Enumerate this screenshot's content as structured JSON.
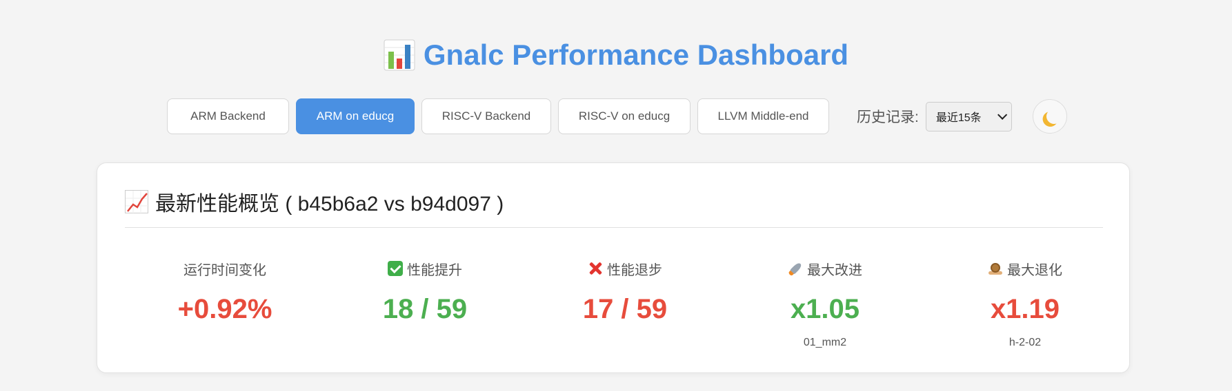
{
  "header": {
    "title": "Gnalc Performance Dashboard",
    "icon": "bar-chart-icon"
  },
  "tabs": [
    {
      "label": "ARM Backend",
      "active": false
    },
    {
      "label": "ARM on educg",
      "active": true
    },
    {
      "label": "RISC-V Backend",
      "active": false
    },
    {
      "label": "RISC-V on educg",
      "active": false
    },
    {
      "label": "LLVM Middle-end",
      "active": false
    }
  ],
  "history": {
    "label": "历史记录:",
    "selected": "最近15条"
  },
  "theme_toggle": {
    "icon": "moon-icon"
  },
  "overview": {
    "title": "最新性能概览 ( b45b6a2 vs b94d097 )",
    "icon": "chart-increasing-icon",
    "stats": [
      {
        "label": "运行时间变化",
        "value": "+0.92%",
        "sub": "",
        "icon": "",
        "color": "#e74c3c"
      },
      {
        "label": "性能提升",
        "value": "18 / 59",
        "sub": "",
        "icon": "check-icon",
        "color": "#4caf50"
      },
      {
        "label": "性能退步",
        "value": "17 / 59",
        "sub": "",
        "icon": "cross-icon",
        "color": "#e74c3c"
      },
      {
        "label": "最大改进",
        "value": "x1.05",
        "sub": "01_mm2",
        "icon": "rocket-icon",
        "color": "#4caf50"
      },
      {
        "label": "最大退化",
        "value": "x1.19",
        "sub": "h-2-02",
        "icon": "snail-icon",
        "color": "#e74c3c"
      }
    ]
  },
  "colors": {
    "accent": "#4a90e2",
    "positive": "#4caf50",
    "negative": "#e74c3c"
  }
}
